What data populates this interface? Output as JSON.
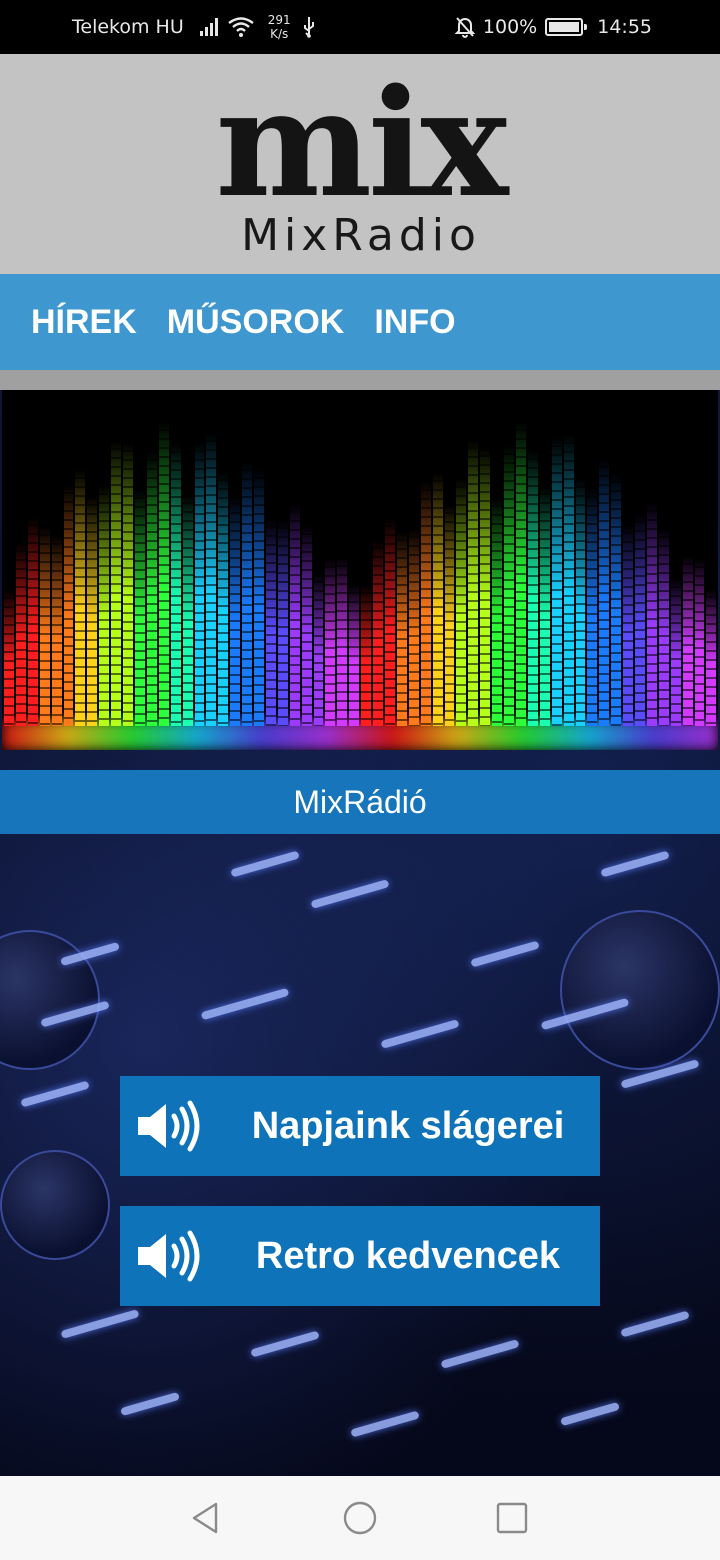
{
  "status_bar": {
    "carrier": "Telekom HU",
    "speed_value": "291",
    "speed_unit": "K/s",
    "battery": "100%",
    "time": "14:55"
  },
  "header": {
    "logo_word": "mix",
    "logo_text": "MixRadio"
  },
  "nav": {
    "tabs": [
      "HÍREK",
      "MŰSOROK",
      "INFO"
    ]
  },
  "station": {
    "name": "MixRádió"
  },
  "buttons": [
    {
      "label": "Napjaink slágerei",
      "icon": "speaker-icon"
    },
    {
      "label": "Retro kedvencek",
      "icon": "speaker-icon"
    }
  ],
  "android_nav": {
    "icons": [
      "back-icon",
      "home-icon",
      "recents-icon"
    ]
  },
  "colors": {
    "header_bg": "#c3c3c3",
    "nav_bg": "#3e97cf",
    "station_bg": "#1775bb",
    "button_bg": "#0f73b9"
  }
}
